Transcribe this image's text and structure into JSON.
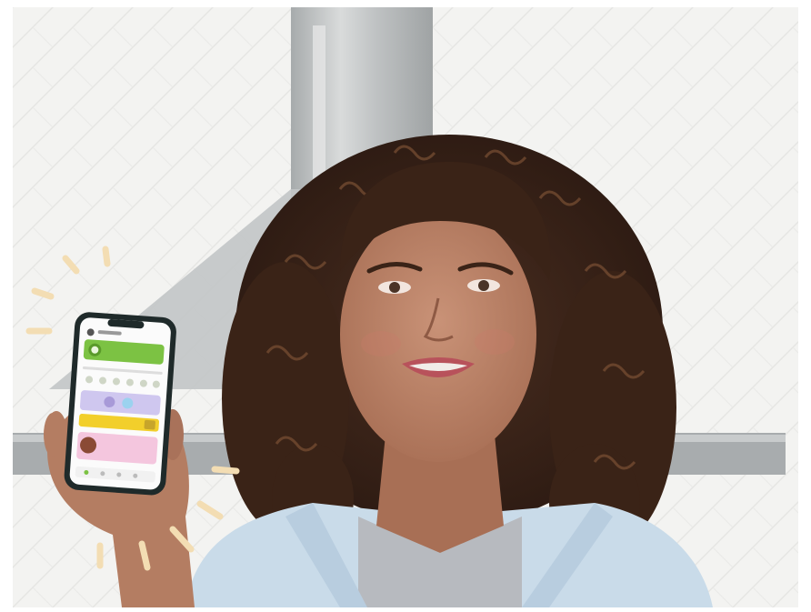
{
  "scene": {
    "subject": "person-holding-phone",
    "phone_screen": {
      "sections": [
        "header",
        "green-card",
        "icon-row",
        "purple-card",
        "yellow-card",
        "pink-card",
        "tab-bar"
      ]
    },
    "colors": {
      "wall_tile": "#ececea",
      "hood_steel": "#b9bcbd",
      "shelf": "#a8acae",
      "skin": "#b98267",
      "hair": "#3b2419",
      "shirt": "#c9dbe9",
      "undershirt": "#b7babf",
      "phone_body": "#1f2a2a",
      "phone_green": "#7cc243",
      "phone_purple": "#cfc7ef",
      "phone_yellow": "#f2cf2b",
      "phone_pink": "#f4c6de",
      "sparkle": "#f3ddb3"
    },
    "icons": [
      "sparkle-icon"
    ]
  }
}
